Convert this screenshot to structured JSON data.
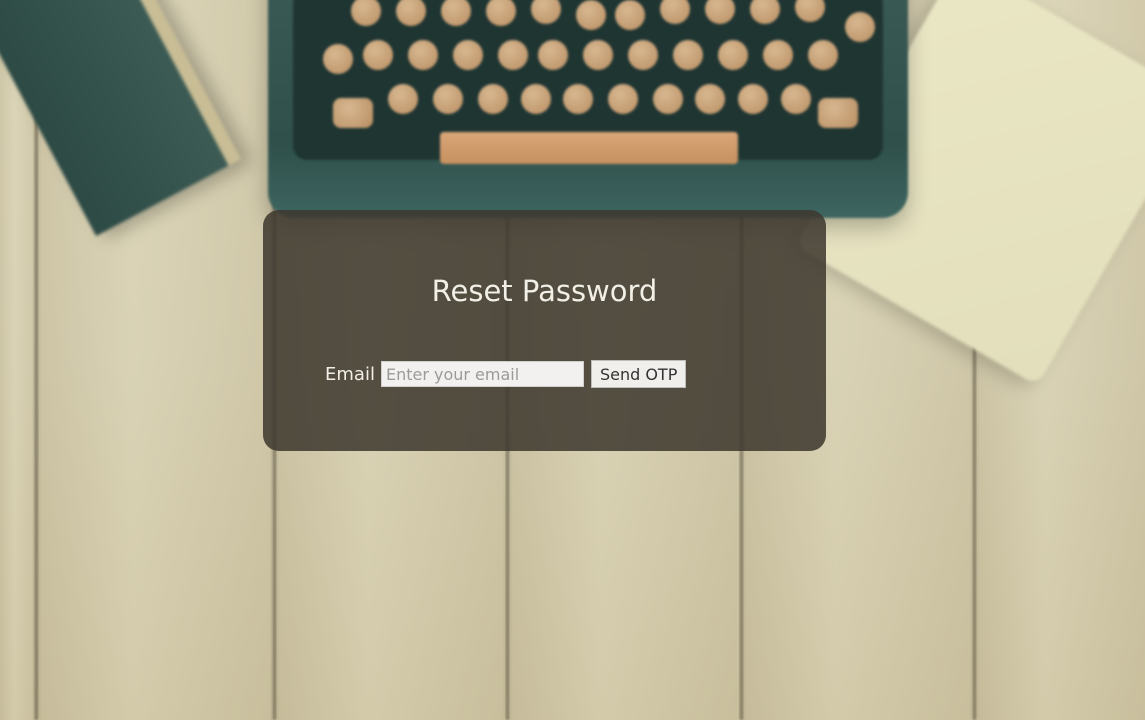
{
  "background": {
    "scene": "wooden-desk-with-typewriter",
    "colors": {
      "wood": "#d8d1b2",
      "typewriter": "#2f504b",
      "keys": "#c99a6d",
      "book": "#2d4a45",
      "notebook": "#e6e2c0"
    }
  },
  "card": {
    "title": "Reset Password",
    "background_color": "#3e382e",
    "form": {
      "email_label": "Email",
      "email_value": "",
      "email_placeholder": "Enter your email",
      "submit_label": "Send OTP"
    }
  }
}
